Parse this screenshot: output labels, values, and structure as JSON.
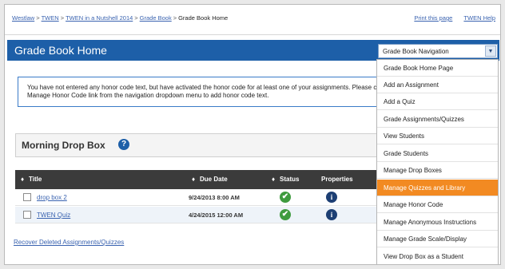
{
  "breadcrumb": {
    "items": [
      "Westlaw",
      "TWEN",
      "TWEN in a Nutshell 2014",
      "Grade Book"
    ],
    "separator": ">",
    "current": "Grade Book Home"
  },
  "top_links": {
    "print": "Print this page",
    "help": "TWEN Help"
  },
  "page_title": "Grade Book Home",
  "notice": "You have not entered any honor code text, but have activated the honor code for at least one of your assignments. Please click the Manage Honor Code link from the navigation dropdown menu to add honor code text.",
  "dropbox": {
    "title": "Morning Drop Box",
    "help_glyph": "?"
  },
  "table": {
    "sort_glyph": "♦",
    "headers": {
      "title": "Title",
      "due": "Due Date",
      "status": "Status",
      "properties": "Properties"
    },
    "rows": [
      {
        "title": "drop box 2",
        "due": "9/24/2013 8:00 AM",
        "status_icon": "check-icon",
        "status_glyph": "✔",
        "prop_glyph": "i"
      },
      {
        "title": "TWEN Quiz",
        "due": "4/24/2015 12:00 AM",
        "status_icon": "check-icon",
        "status_glyph": "✔",
        "prop_glyph": "i"
      }
    ]
  },
  "recover_link": "Recover Deleted Assignments/Quizzes",
  "nav": {
    "label": "Grade Book Navigation",
    "arrow_glyph": "▼",
    "items": [
      "Grade Book Home Page",
      "Add an Assignment",
      "Add a Quiz",
      "Grade Assignments/Quizzes",
      "View Students",
      "Grade Students",
      "Manage Drop Boxes",
      "Manage Quizzes and Library",
      "Manage Honor Code",
      "Manage Anonymous Instructions",
      "Manage Grade Scale/Display",
      "View Drop Box as a Student"
    ],
    "highlighted": "Manage Quizzes and Library"
  },
  "colors": {
    "title_bar": "#1d5fa8",
    "highlight": "#f28a22",
    "link": "#3a63b0",
    "header": "#3b3b3b"
  }
}
